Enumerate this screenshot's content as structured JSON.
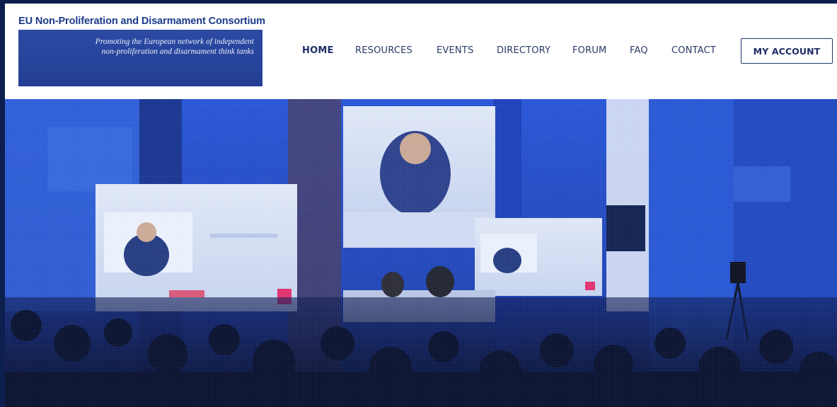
{
  "site": {
    "title": "EU Non-Proliferation and Disarmament Consortium",
    "tagline_line1": "Promoting the European network of independent",
    "tagline_line2": "non-proliferation and disarmament think tanks"
  },
  "nav": {
    "items": [
      {
        "label": "HOME",
        "active": true
      },
      {
        "label": "RESOURCES",
        "active": false
      },
      {
        "label": "EVENTS",
        "active": false
      },
      {
        "label": "DIRECTORY",
        "active": false
      },
      {
        "label": "FORUM",
        "active": false
      },
      {
        "label": "FAQ",
        "active": false
      },
      {
        "label": "CONTACT",
        "active": false
      }
    ],
    "account_label": "MY ACCOUNT"
  },
  "colors": {
    "brand": "#1c3a8a",
    "logo_bg": "#2c4aa3",
    "hero_blue": "#1a43b9",
    "frame_bg": "#0d1f4f"
  },
  "hero": {
    "image": "conference-photo"
  }
}
